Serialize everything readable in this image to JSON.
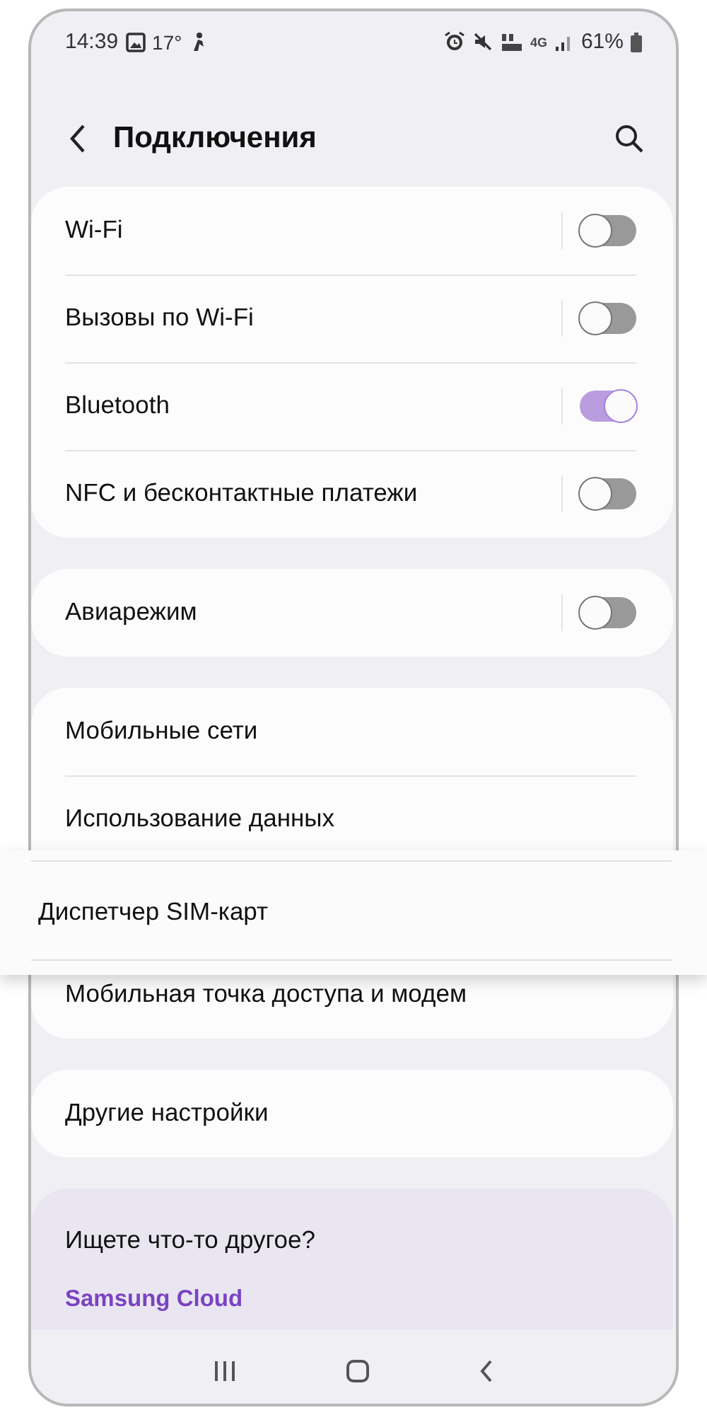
{
  "status_bar": {
    "time": "14:39",
    "temperature": "17°",
    "network": "4G",
    "battery": "61%"
  },
  "header": {
    "title": "Подключения"
  },
  "sections": [
    {
      "items": [
        {
          "label": "Wi-Fi",
          "kind": "toggle",
          "on": false
        },
        {
          "label": "Вызовы по Wi-Fi",
          "kind": "toggle",
          "on": false
        },
        {
          "label": "Bluetooth",
          "kind": "toggle",
          "on": true
        },
        {
          "label": "NFC и бесконтактные платежи",
          "kind": "toggle",
          "on": false
        }
      ]
    },
    {
      "items": [
        {
          "label": "Авиарежим",
          "kind": "toggle",
          "on": false
        }
      ]
    },
    {
      "items": [
        {
          "label": "Мобильные сети",
          "kind": "link",
          "dragging": false
        },
        {
          "label": "Использование данных",
          "kind": "link",
          "dragging": false
        },
        {
          "label": "Диспетчер SIM-карт",
          "kind": "link",
          "dragging": true
        },
        {
          "label": "Мобильная точка доступа и модем",
          "kind": "link",
          "dragging": false
        }
      ]
    },
    {
      "items": [
        {
          "label": "Другие настройки",
          "kind": "link",
          "dragging": false
        }
      ]
    }
  ],
  "suggestions": {
    "title": "Ищете что-то другое?",
    "link": "Samsung Cloud"
  }
}
